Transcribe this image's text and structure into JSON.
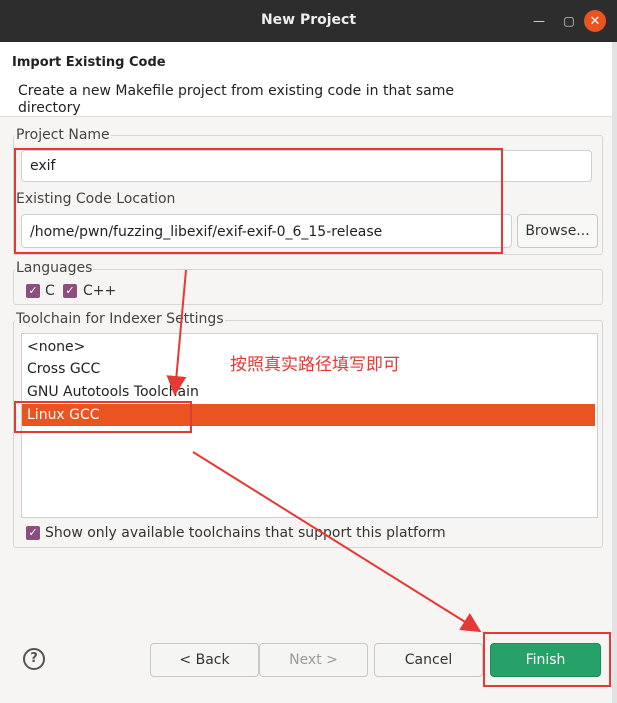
{
  "window": {
    "title": "New Project"
  },
  "titlebar": {
    "min_icon": "minimize-icon",
    "max_icon": "maximize-icon",
    "close_icon": "close-icon"
  },
  "header": {
    "title": "Import Existing Code",
    "description": "Create a new Makefile project from existing code in that same directory"
  },
  "project_name": {
    "label": "Project Name",
    "value": "exif"
  },
  "code_location": {
    "label": "Existing Code Location",
    "value": "/home/pwn/fuzzing_libexif/exif-exif-0_6_15-release",
    "browse_label": "Browse..."
  },
  "languages": {
    "label": "Languages",
    "items": [
      {
        "label": "C",
        "checked": true
      },
      {
        "label": "C++",
        "checked": true
      }
    ]
  },
  "toolchain": {
    "label": "Toolchain for Indexer Settings",
    "items": [
      "<none>",
      "Cross GCC",
      "GNU Autotools Toolchain",
      "Linux GCC"
    ],
    "selected": "Linux GCC",
    "show_only_label": "Show only available toolchains that support this platform"
  },
  "annotation": {
    "text": "按照真实路径填写即可"
  },
  "footer": {
    "help_icon": "help-icon",
    "back": "< Back",
    "next": "Next >",
    "cancel": "Cancel",
    "finish": "Finish"
  },
  "colors": {
    "accent": "#e95420",
    "finish": "#26a269",
    "annotation": "#e53935",
    "checkbox": "#8a4f7d"
  }
}
